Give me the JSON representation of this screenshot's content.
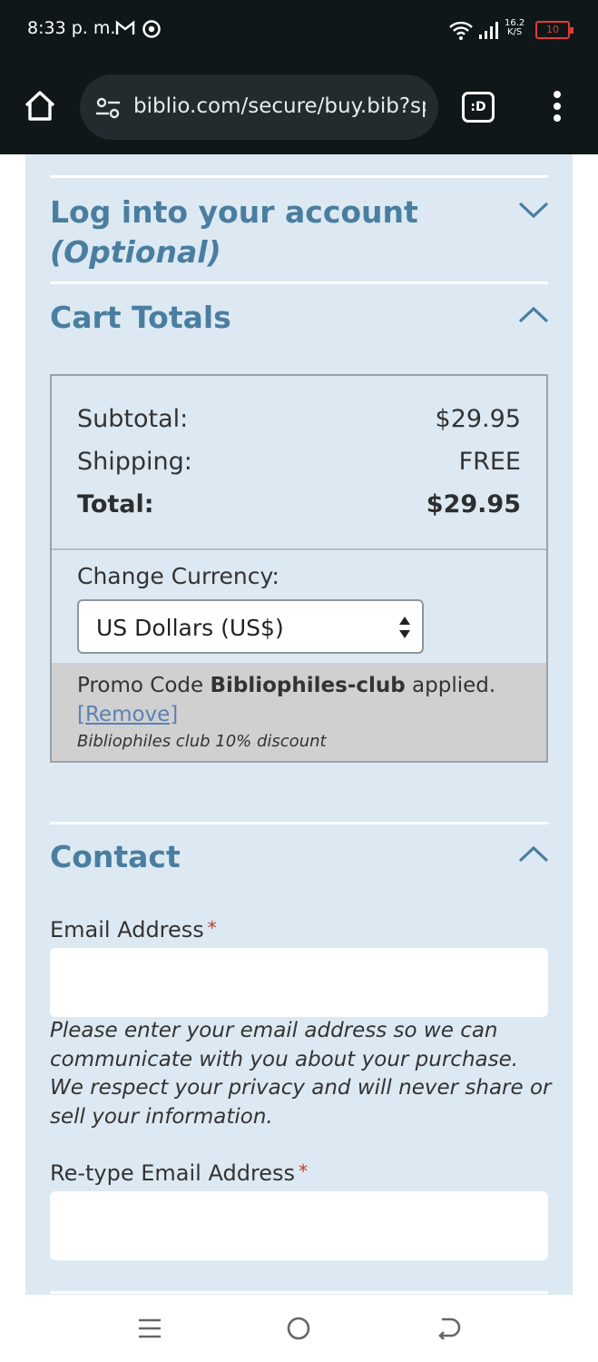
{
  "status_bar": {
    "time": "8:33 p. m.",
    "net_speed_value": "16.2",
    "net_speed_unit": "K/S",
    "battery": "10",
    "icons": [
      "gmail-icon",
      "chrome-icon",
      "wifi-icon",
      "signal-icon",
      "battery-icon"
    ]
  },
  "browser": {
    "url": "biblio.com/secure/buy.bib?sp",
    "tabs_label": ":D"
  },
  "login_section": {
    "title": "Log into your account",
    "subtitle": "(Optional)"
  },
  "cart_section": {
    "title": "Cart Totals",
    "rows": [
      {
        "label": "Subtotal:",
        "value": "$29.95"
      },
      {
        "label": "Shipping:",
        "value": "FREE"
      },
      {
        "label": "Total:",
        "value": "$29.95"
      }
    ],
    "currency_label": "Change Currency:",
    "currency_selected": "US Dollars (US$)",
    "promo": {
      "prefix": "Promo Code",
      "code": "Bibliophiles-club",
      "suffix": "applied.",
      "remove_label": "[Remove]",
      "note": "Bibliophiles club 10% discount"
    }
  },
  "contact_section": {
    "title": "Contact",
    "email_label": "Email Address",
    "required_mark": "*",
    "email_value": "",
    "email_help": "Please enter your email address so we can communicate with you about your purchase. We respect your privacy and will never share or sell your information.",
    "retype_label": "Re-type Email Address",
    "retype_value": ""
  },
  "colors": {
    "panel_bg": "#dce9f3",
    "heading": "#4a7ea0",
    "promo_bg": "#d0d0d0",
    "link": "#5b82b4"
  }
}
